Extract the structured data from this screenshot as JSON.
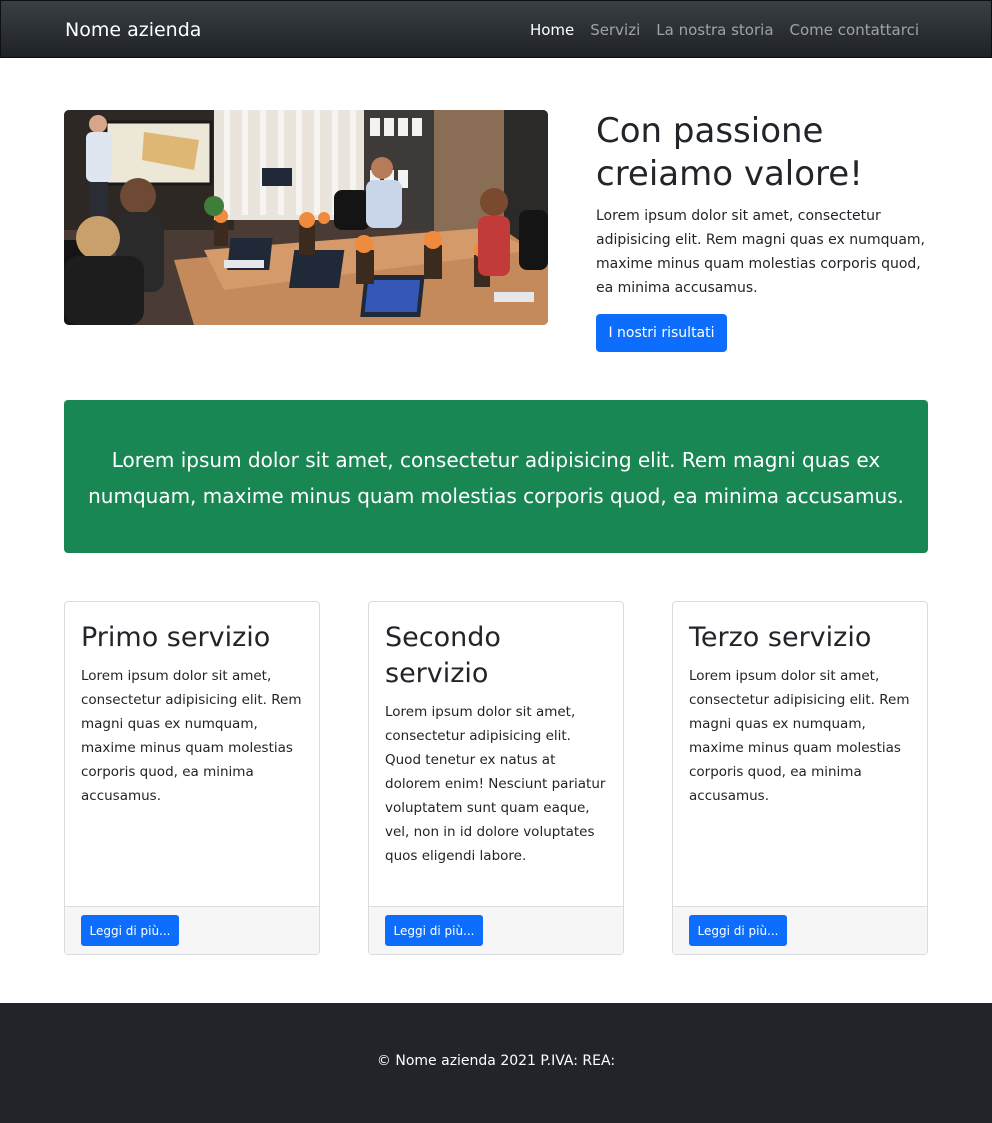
{
  "navbar": {
    "brand": "Nome azienda",
    "items": [
      {
        "label": "Home",
        "active": true
      },
      {
        "label": "Servizi",
        "active": false
      },
      {
        "label": "La nostra storia",
        "active": false
      },
      {
        "label": "Come contattarci",
        "active": false
      }
    ]
  },
  "hero": {
    "title": "Con passione creiamo valore!",
    "text": "Lorem ipsum dolor sit amet, consectetur adipisicing elit. Rem magni quas ex numquam, maxime minus quam molestias corporis quod, ea minima accusamus.",
    "button_label": "I nostri risultati"
  },
  "banner": {
    "text": "Lorem ipsum dolor sit amet, consectetur adipisicing elit. Rem magni quas ex numquam, maxime minus quam molestias corporis quod, ea minima accusamus."
  },
  "services": [
    {
      "title": "Primo servizio",
      "text": "Lorem ipsum dolor sit amet, consectetur adipisicing elit. Rem magni quas ex numquam, maxime minus quam molestias corporis quod, ea minima accusamus.",
      "button_label": "Leggi di più..."
    },
    {
      "title": "Secondo servizio",
      "text": "Lorem ipsum dolor sit amet, consectetur adipisicing elit. Quod tenetur ex natus at dolorem enim! Nesciunt pariatur voluptatem sunt quam eaque, vel, non in id dolore voluptates quos eligendi labore.",
      "button_label": "Leggi di più..."
    },
    {
      "title": "Terzo servizio",
      "text": "Lorem ipsum dolor sit amet, consectetur adipisicing elit. Rem magni quas ex numquam, maxime minus quam molestias corporis quod, ea minima accusamus.",
      "button_label": "Leggi di più..."
    }
  ],
  "footer": {
    "text": "© Nome azienda 2021 P.IVA: REA:"
  },
  "colors": {
    "primary": "#0d6efd",
    "success": "#198754",
    "dark": "#212529"
  }
}
